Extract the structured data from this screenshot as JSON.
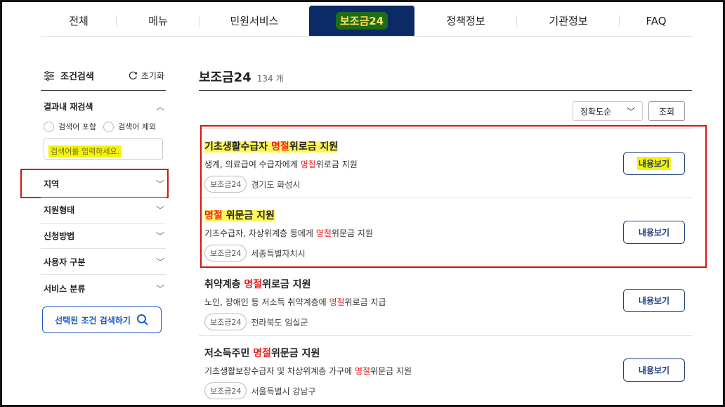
{
  "tabs": [
    "전체",
    "메뉴",
    "민원서비스",
    "보조금24",
    "정책정보",
    "기관정보",
    "FAQ"
  ],
  "sidebar": {
    "title": "조건검색",
    "reset": "초기화",
    "within_search": "결과내 재검색",
    "include": "검색어 포함",
    "exclude": "검색어 제외",
    "placeholder": "검색어를 입력하세요.",
    "sections": [
      "지역",
      "지원형태",
      "신청방법",
      "사용자 구분",
      "서비스 분류"
    ],
    "search_button": "선택된 조건 검색하기"
  },
  "main": {
    "title": "보조금24",
    "count": "134 개",
    "sort": "정확도순",
    "query": "조회",
    "items": [
      {
        "title_a": "기초생활수급자 ",
        "title_red": "명절",
        "title_b": "위로금 지원",
        "desc_a": "생계, 의료급여 수급자에게 ",
        "desc_red": "명절",
        "desc_b": "위로금 지원",
        "chip": "보조금24",
        "region": "경기도 화성시",
        "button": "내용보기"
      },
      {
        "title_a": "",
        "title_red": "명절",
        "title_b": " 위문금 지원",
        "desc_a": "기초수급자, 차상위계층 등에게 ",
        "desc_red": "명절",
        "desc_b": "위문금 지원",
        "chip": "보조금24",
        "region": "세종특별자치시",
        "button": "내용보기"
      },
      {
        "title_a": "취약계층 ",
        "title_red": "명절",
        "title_b": "위로금 지원",
        "desc_a": "노인, 장애인 등 저소득 취약계층에 ",
        "desc_red": "명절",
        "desc_b": "위로금 지급",
        "chip": "보조금24",
        "region": "전라북도 임실군",
        "button": "내용보기"
      },
      {
        "title_a": "저소득주민 ",
        "title_red": "명절",
        "title_b": "위문금 지원",
        "desc_a": "기초생활보장수급자 및 차상위계층 가구에 ",
        "desc_red": "명절",
        "desc_b": "위문금 지원",
        "chip": "보조금24",
        "region": "서울특별시 강남구",
        "button": "내용보기"
      }
    ]
  }
}
